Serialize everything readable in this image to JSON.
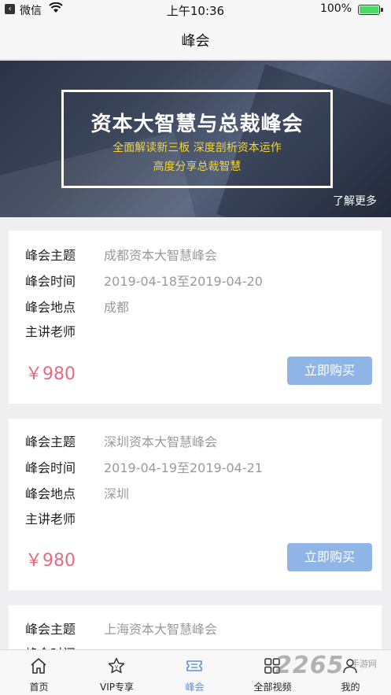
{
  "status_bar": {
    "carrier": "微信",
    "time": "上午10:36",
    "battery": "100%"
  },
  "nav": {
    "title": "峰会"
  },
  "banner": {
    "title": "资本大智慧与总裁峰会",
    "subtitle_line1": "全面解读新三板 深度剖析资本运作",
    "subtitle_line2": "高度分享总裁智慧",
    "more": "了解更多"
  },
  "labels": {
    "topic": "峰会主题",
    "time": "峰会时间",
    "place": "峰会地点",
    "teacher": "主讲老师"
  },
  "summits": [
    {
      "topic": "成都资本大智慧峰会",
      "time": "2019-04-18至2019-04-20",
      "place": "成都",
      "teacher": "",
      "price": "￥980",
      "buy": "立即购买"
    },
    {
      "topic": "深圳资本大智慧峰会",
      "time": "2019-04-19至2019-04-21",
      "place": "深圳",
      "teacher": "",
      "price": "￥980",
      "buy": "立即购买"
    },
    {
      "topic": "上海资本大智慧峰会"
    }
  ],
  "tabs": [
    {
      "label": "首页",
      "icon": "home-icon"
    },
    {
      "label": "VIP专享",
      "icon": "star-icon"
    },
    {
      "label": "峰会",
      "icon": "ticket-icon",
      "active": true
    },
    {
      "label": "全部视频",
      "icon": "grid-icon"
    },
    {
      "label": "我的",
      "icon": "person-icon"
    }
  ],
  "watermark": {
    "brand": "2265",
    "sub": "手游网"
  },
  "colors": {
    "accent": "#5a8fd8",
    "price": "#e66a80",
    "button": "#8fb4e6",
    "banner_text": "#f2d43a"
  }
}
